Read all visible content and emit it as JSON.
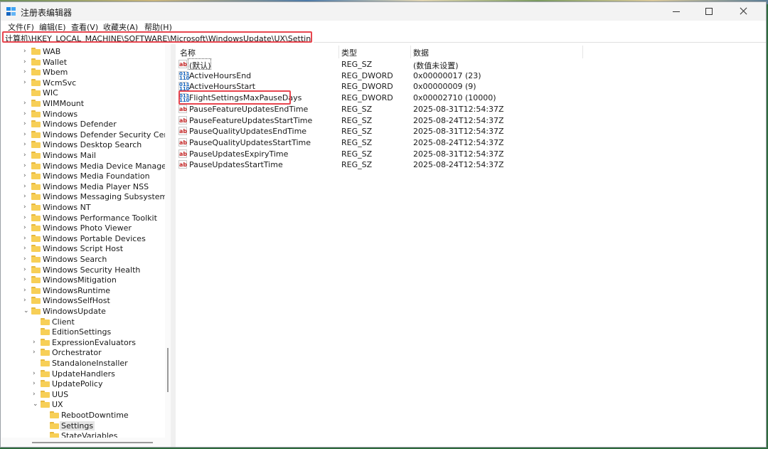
{
  "window": {
    "title": "注册表编辑器"
  },
  "menu": [
    "文件(F)",
    "编辑(E)",
    "查看(V)",
    "收藏夹(A)",
    "帮助(H)"
  ],
  "address": "计算机\\HKEY_LOCAL_MACHINE\\SOFTWARE\\Microsoft\\WindowsUpdate\\UX\\Settings",
  "tree": [
    {
      "label": "WAB",
      "level": 1,
      "expander": "collapsed"
    },
    {
      "label": "Wallet",
      "level": 1,
      "expander": "collapsed"
    },
    {
      "label": "Wbem",
      "level": 1,
      "expander": "collapsed"
    },
    {
      "label": "WcmSvc",
      "level": 1,
      "expander": "collapsed"
    },
    {
      "label": "WIC",
      "level": 1,
      "expander": "none"
    },
    {
      "label": "WIMMount",
      "level": 1,
      "expander": "collapsed"
    },
    {
      "label": "Windows",
      "level": 1,
      "expander": "collapsed"
    },
    {
      "label": "Windows Defender",
      "level": 1,
      "expander": "collapsed"
    },
    {
      "label": "Windows Defender Security Center",
      "level": 1,
      "expander": "collapsed"
    },
    {
      "label": "Windows Desktop Search",
      "level": 1,
      "expander": "collapsed"
    },
    {
      "label": "Windows Mail",
      "level": 1,
      "expander": "collapsed"
    },
    {
      "label": "Windows Media Device Manager",
      "level": 1,
      "expander": "collapsed"
    },
    {
      "label": "Windows Media Foundation",
      "level": 1,
      "expander": "collapsed"
    },
    {
      "label": "Windows Media Player NSS",
      "level": 1,
      "expander": "collapsed"
    },
    {
      "label": "Windows Messaging Subsystem",
      "level": 1,
      "expander": "collapsed"
    },
    {
      "label": "Windows NT",
      "level": 1,
      "expander": "collapsed"
    },
    {
      "label": "Windows Performance Toolkit",
      "level": 1,
      "expander": "collapsed"
    },
    {
      "label": "Windows Photo Viewer",
      "level": 1,
      "expander": "collapsed"
    },
    {
      "label": "Windows Portable Devices",
      "level": 1,
      "expander": "collapsed"
    },
    {
      "label": "Windows Script Host",
      "level": 1,
      "expander": "collapsed"
    },
    {
      "label": "Windows Search",
      "level": 1,
      "expander": "collapsed"
    },
    {
      "label": "Windows Security Health",
      "level": 1,
      "expander": "collapsed"
    },
    {
      "label": "WindowsMitigation",
      "level": 1,
      "expander": "collapsed"
    },
    {
      "label": "WindowsRuntime",
      "level": 1,
      "expander": "collapsed"
    },
    {
      "label": "WindowsSelfHost",
      "level": 1,
      "expander": "collapsed"
    },
    {
      "label": "WindowsUpdate",
      "level": 1,
      "expander": "expanded"
    },
    {
      "label": "Client",
      "level": 2,
      "expander": "none"
    },
    {
      "label": "EditionSettings",
      "level": 2,
      "expander": "none"
    },
    {
      "label": "ExpressionEvaluators",
      "level": 2,
      "expander": "collapsed"
    },
    {
      "label": "Orchestrator",
      "level": 2,
      "expander": "collapsed"
    },
    {
      "label": "StandaloneInstaller",
      "level": 2,
      "expander": "none"
    },
    {
      "label": "UpdateHandlers",
      "level": 2,
      "expander": "collapsed"
    },
    {
      "label": "UpdatePolicy",
      "level": 2,
      "expander": "collapsed"
    },
    {
      "label": "UUS",
      "level": 2,
      "expander": "collapsed"
    },
    {
      "label": "UX",
      "level": 2,
      "expander": "expanded"
    },
    {
      "label": "RebootDowntime",
      "level": 3,
      "expander": "none"
    },
    {
      "label": "Settings",
      "level": 3,
      "expander": "none",
      "selected": true
    },
    {
      "label": "StateVariables",
      "level": 3,
      "expander": "none"
    }
  ],
  "columns": {
    "name": "名称",
    "type": "类型",
    "data": "数据"
  },
  "values": [
    {
      "name": "(默认)",
      "type": "REG_SZ",
      "data": "(数值未设置)",
      "icon": "string-value-icon"
    },
    {
      "name": "ActiveHoursEnd",
      "type": "REG_DWORD",
      "data": "0x00000017 (23)",
      "icon": "dword-value-icon"
    },
    {
      "name": "ActiveHoursStart",
      "type": "REG_DWORD",
      "data": "0x00000009 (9)",
      "icon": "dword-value-icon"
    },
    {
      "name": "FlightSettingsMaxPauseDays",
      "type": "REG_DWORD",
      "data": "0x00002710 (10000)",
      "icon": "dword-value-icon",
      "highlighted": true
    },
    {
      "name": "PauseFeatureUpdatesEndTime",
      "type": "REG_SZ",
      "data": "2025-08-31T12:54:37Z",
      "icon": "string-value-icon"
    },
    {
      "name": "PauseFeatureUpdatesStartTime",
      "type": "REG_SZ",
      "data": "2025-08-24T12:54:37Z",
      "icon": "string-value-icon"
    },
    {
      "name": "PauseQualityUpdatesEndTime",
      "type": "REG_SZ",
      "data": "2025-08-31T12:54:37Z",
      "icon": "string-value-icon"
    },
    {
      "name": "PauseQualityUpdatesStartTime",
      "type": "REG_SZ",
      "data": "2025-08-24T12:54:37Z",
      "icon": "string-value-icon"
    },
    {
      "name": "PauseUpdatesExpiryTime",
      "type": "REG_SZ",
      "data": "2025-08-31T12:54:37Z",
      "icon": "string-value-icon"
    },
    {
      "name": "PauseUpdatesStartTime",
      "type": "REG_SZ",
      "data": "2025-08-24T12:54:37Z",
      "icon": "string-value-icon"
    }
  ],
  "colors": {
    "highlight_border": "#e8464f",
    "folder": "#f7cf57"
  }
}
